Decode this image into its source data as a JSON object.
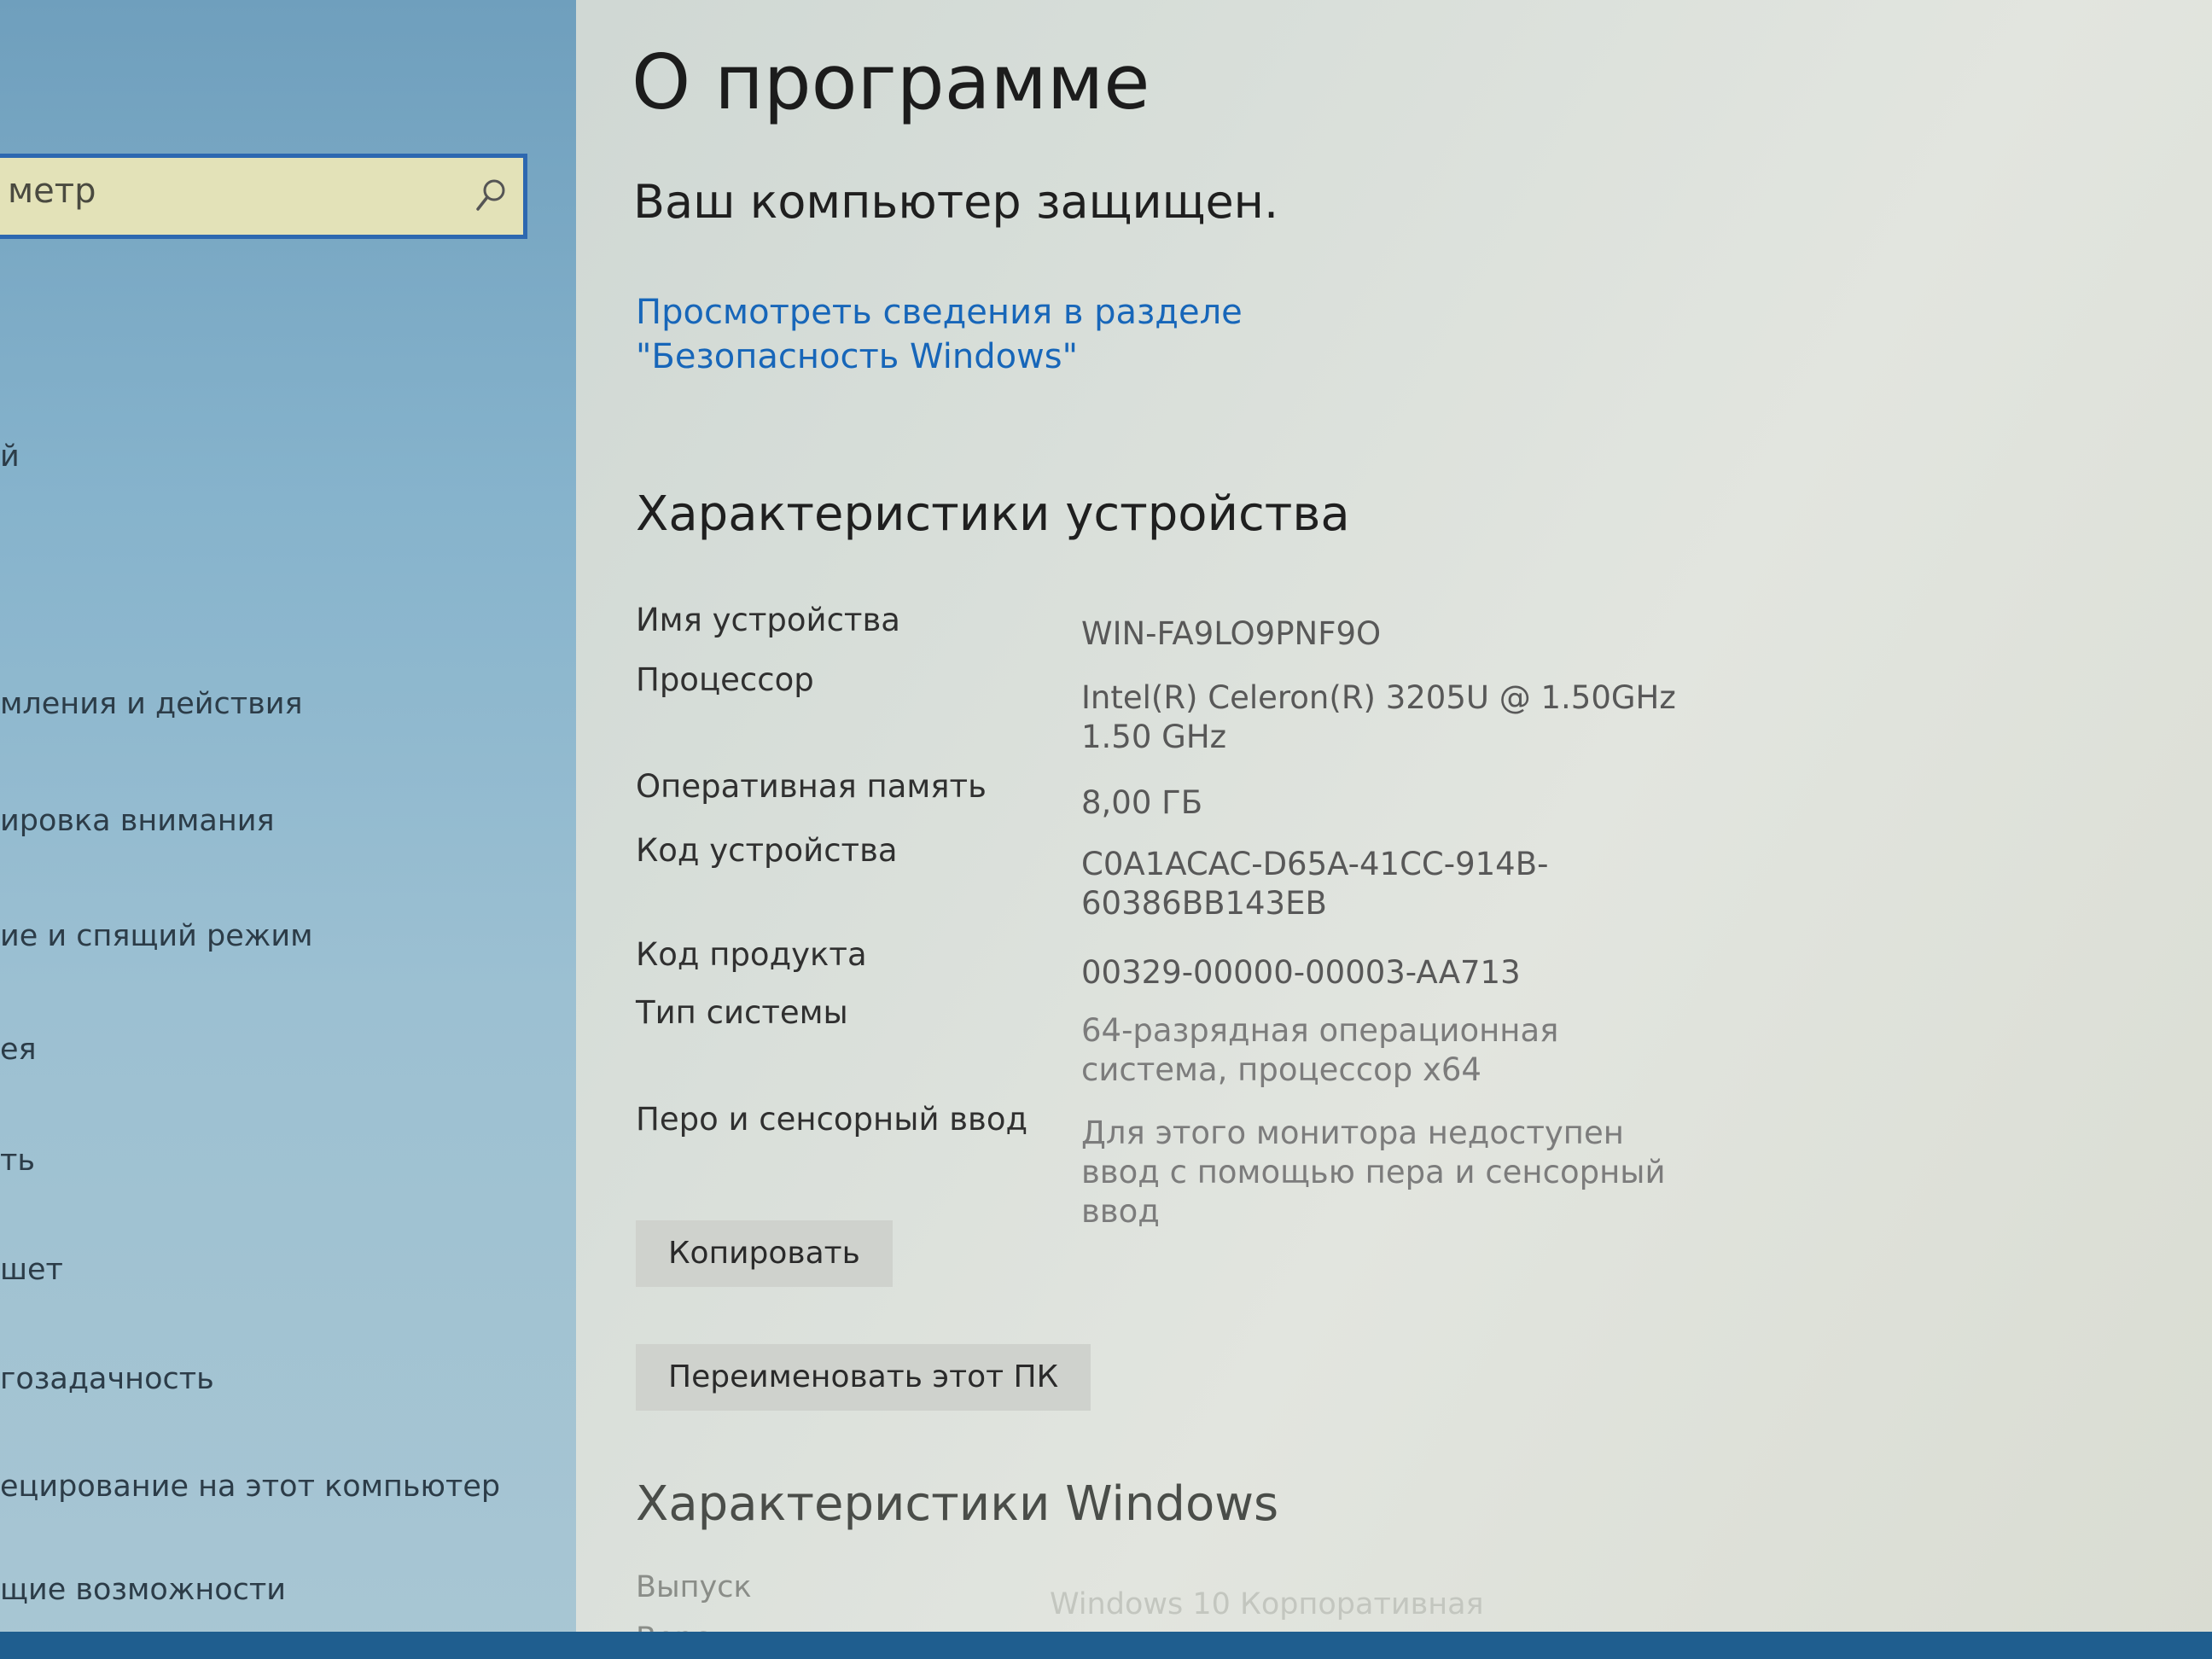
{
  "sidebar": {
    "search": {
      "value": "метр"
    },
    "items": [
      {
        "label": "й"
      },
      {
        "label": "мления и действия"
      },
      {
        "label": "ировка внимания"
      },
      {
        "label": "ие и спящий режим"
      },
      {
        "label": "ея"
      },
      {
        "label": "ть"
      },
      {
        "label": "шет"
      },
      {
        "label": "гозадачность"
      },
      {
        "label": "ецирование на этот компьютер"
      },
      {
        "label": "щие возможности"
      }
    ]
  },
  "main": {
    "title": "О программе",
    "protection_status": "Ваш компьютер защищен.",
    "security_link": "Просмотреть сведения в разделе \"Безопасность Windows\"",
    "device_specs": {
      "header": "Характеристики устройства",
      "rows": [
        {
          "label": "Имя устройства",
          "value": "WIN-FA9LO9PNF9O"
        },
        {
          "label": "Процессор",
          "value": "Intel(R) Celeron(R) 3205U @ 1.50GHz   1.50 GHz"
        },
        {
          "label": "Оперативная память",
          "value": "8,00 ГБ"
        },
        {
          "label": "Код устройства",
          "value": "C0A1ACAC-D65A-41CC-914B-60386BB143EB"
        },
        {
          "label": "Код продукта",
          "value": "00329-00000-00003-AA713"
        },
        {
          "label": "Тип системы",
          "value": "64-разрядная операционная система, процессор x64"
        },
        {
          "label": "Перо и сенсорный ввод",
          "value": "Для этого монитора недоступен ввод с помощью пера и сенсорный ввод"
        }
      ]
    },
    "buttons": {
      "copy": "Копировать",
      "rename": "Переименовать этот ПК"
    },
    "windows_specs": {
      "header": "Характеристики Windows",
      "rows": [
        {
          "label": "Выпуск",
          "value": "Windows 10 Корпоративная"
        },
        {
          "label": "Версия",
          "value": ""
        }
      ]
    }
  },
  "colors": {
    "accent_link": "#1766b9",
    "search_border": "#2d68b0",
    "taskbar": "#1f5e8f"
  }
}
